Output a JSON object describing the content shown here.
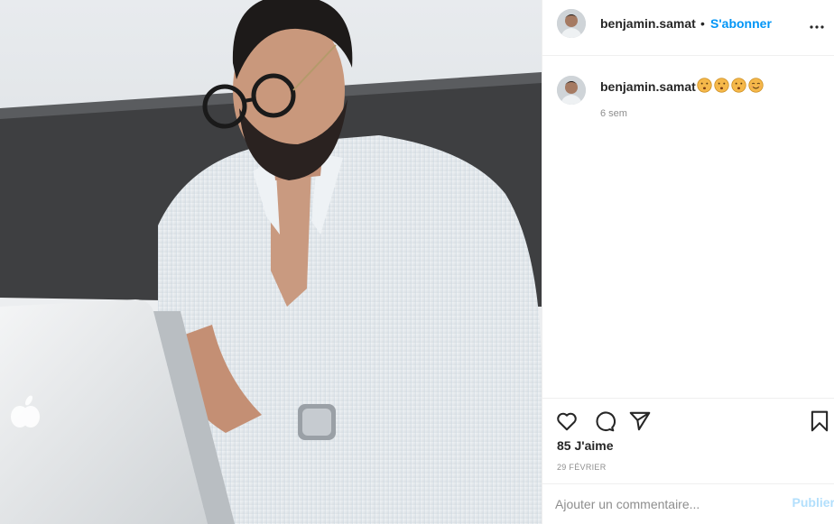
{
  "post": {
    "image_alt": "Homme à lunettes en chemise blanche travaillant sur un ordinateur portable",
    "author": {
      "username": "benjamin.samat",
      "separator": "•",
      "follow_label": "S'abonner"
    },
    "caption": {
      "username": "benjamin.samat",
      "emojis": [
        "kissing-face",
        "kissing-face",
        "kissing-face",
        "smiling-face"
      ],
      "time_ago": "6 sem"
    },
    "likes": "85 J'aime",
    "date": "29 FÉVRIER",
    "comment": {
      "placeholder": "Ajouter un commentaire...",
      "value": "",
      "post_label": "Publier"
    }
  },
  "icons": {
    "more": "more-icon",
    "like": "heart-icon",
    "comment": "comment-icon",
    "share": "paper-plane-icon",
    "save": "bookmark-icon"
  },
  "colors": {
    "accent": "#0095f6",
    "accent_disabled": "#b2dffc",
    "text": "#262626",
    "secondary": "#8e8e8e",
    "border": "#efefef"
  }
}
